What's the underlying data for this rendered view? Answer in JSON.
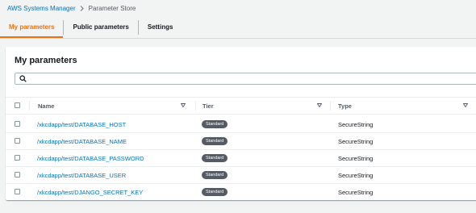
{
  "breadcrumb": {
    "root": "AWS Systems Manager",
    "current": "Parameter Store"
  },
  "tabs": [
    {
      "label": "My parameters",
      "active": true
    },
    {
      "label": "Public parameters",
      "active": false
    },
    {
      "label": "Settings",
      "active": false
    }
  ],
  "panel": {
    "title": "My parameters"
  },
  "search": {
    "value": "",
    "icon": "search-icon"
  },
  "table": {
    "columns": [
      "Name",
      "Tier",
      "Type"
    ],
    "rows": [
      {
        "name": "/xkcdapp/test/DATABASE_HOST",
        "tier": "Standard",
        "type": "SecureString"
      },
      {
        "name": "/xkcdapp/test/DATABASE_NAME",
        "tier": "Standard",
        "type": "SecureString"
      },
      {
        "name": "/xkcdapp/test/DATABASE_PASSWORD",
        "tier": "Standard",
        "type": "SecureString"
      },
      {
        "name": "/xkcdapp/test/DATABASE_USER",
        "tier": "Standard",
        "type": "SecureString"
      },
      {
        "name": "/xkcdapp/test/DJANGO_SECRET_KEY",
        "tier": "Standard",
        "type": "SecureString"
      }
    ]
  },
  "colors": {
    "accent": "#ec7211",
    "link": "#0073bb",
    "badge": "#545b64",
    "background": "#f2f3f3"
  }
}
